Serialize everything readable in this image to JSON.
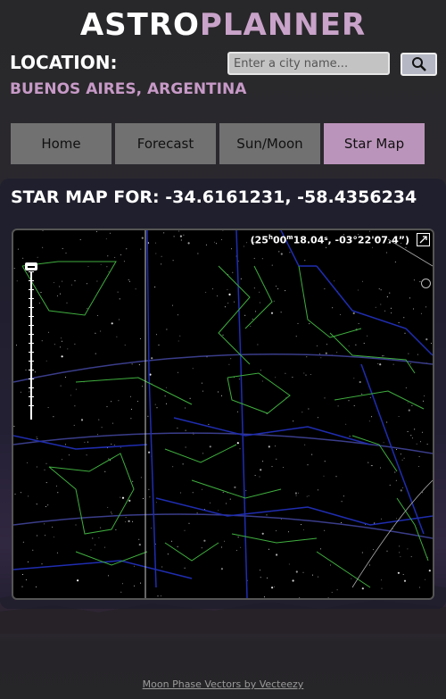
{
  "header": {
    "title_part1": "ASTRO",
    "title_part2": "PLANNER"
  },
  "location": {
    "label": "LOCATION:",
    "value": "BUENOS AIRES, ARGENTINA",
    "search_placeholder": "Enter a city name...",
    "search_icon": "search-icon"
  },
  "tabs": [
    {
      "label": "Home"
    },
    {
      "label": "Forecast"
    },
    {
      "label": "Sun/Moon"
    },
    {
      "label": "Star Map",
      "active": true
    }
  ],
  "starmap": {
    "title": "STAR MAP FOR: -34.6161231, -58.4356234",
    "coords_prefix": "(25",
    "coords_h": "h",
    "coords_mid": "00",
    "coords_m": "m",
    "coords_rest": "18.04ˢ, -03°22'07.4”)"
  },
  "footer": {
    "credit": "Moon Phase Vectors by Vecteezy"
  },
  "colors": {
    "accent": "#c9a3c9",
    "tab_active": "#bb94bb",
    "tab_inactive": "#717171",
    "constellation_lines": "#3fae3f",
    "boundaries": "#1f2db0",
    "grid": "#3a3d8a"
  }
}
